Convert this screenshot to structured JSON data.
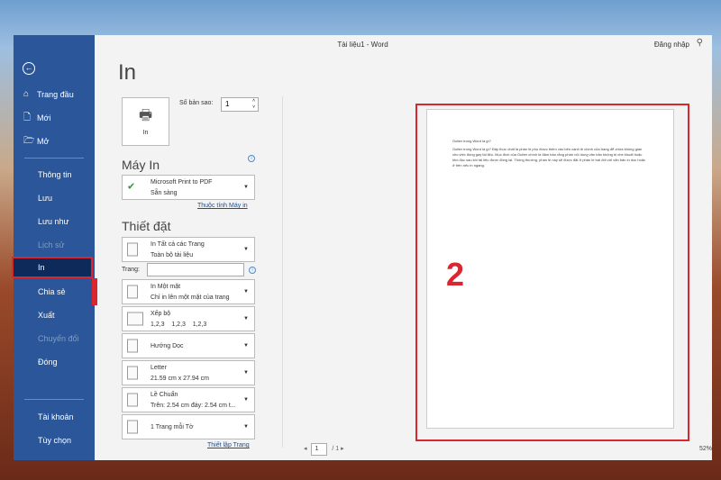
{
  "window": {
    "title": "Tài liệu1  -  Word",
    "sign_in": "Đăng nhập"
  },
  "sidebar": {
    "items": [
      {
        "label": "Trang đầu",
        "icon": "home-icon"
      },
      {
        "label": "Mới",
        "icon": "new-doc-icon"
      },
      {
        "label": "Mở",
        "icon": "folder-icon"
      },
      {
        "label": "Thông tin"
      },
      {
        "label": "Lưu"
      },
      {
        "label": "Lưu như"
      },
      {
        "label": "Lịch sử"
      },
      {
        "label": "In"
      },
      {
        "label": "Chia sẻ"
      },
      {
        "label": "Xuất"
      },
      {
        "label": "Chuyển đổi"
      },
      {
        "label": "Đóng"
      },
      {
        "label": "Tài khoản"
      },
      {
        "label": "Tùy chọn"
      }
    ]
  },
  "print": {
    "heading": "In",
    "button": "In",
    "copies_label": "Số bản sao:",
    "copies": "1",
    "printer_heading": "Máy In",
    "printer_name": "Microsoft Print to PDF",
    "printer_status": "Sẵn sàng",
    "printer_props": "Thuộc tính Máy in",
    "settings_heading": "Thiết đặt",
    "pages_label": "Trang:",
    "pages_value": "",
    "settings": [
      {
        "l1": "In Tất cả các Trang",
        "l2": "Toàn bộ tài liệu"
      },
      {
        "l1": "In Một mặt",
        "l2": "Chỉ in lên một mặt của trang"
      },
      {
        "l1": "Xếp bộ",
        "l2": "1,2,3    1,2,3    1,2,3"
      },
      {
        "l1": "Hướng Dọc",
        "l2": ""
      },
      {
        "l1": "Letter",
        "l2": "21.59 cm x 27.94 cm"
      },
      {
        "l1": "Lề Chuẩn",
        "l2": "Trên: 2.54 cm đáy: 2.54 cm t..."
      },
      {
        "l1": "1 Trang mỗi Tờ",
        "l2": ""
      }
    ],
    "page_setup": "Thiết lập Trang"
  },
  "preview": {
    "heading": "Gutter trong Word là gì?",
    "body": "Gutter trong Word là gì? Đây thực chất là phần lề phụ được thêm vào bên cạnh lề chính của trang để chừa không gian cho việc đóng gáy tài liệu. Mục đích của Gutter chính là đảm bảo rằng phần nội dung văn bản không bị che khuất hoặc khó đọc sau khi tài liệu được đóng lại. Thông thường, phần lề này sẽ được đặt ở phần lề trái đối với văn bản in dọc hoặc ở trên nếu in ngang.",
    "annotation": "2",
    "current_page": "1",
    "total_pages": "/ 1",
    "zoom": "52%"
  }
}
